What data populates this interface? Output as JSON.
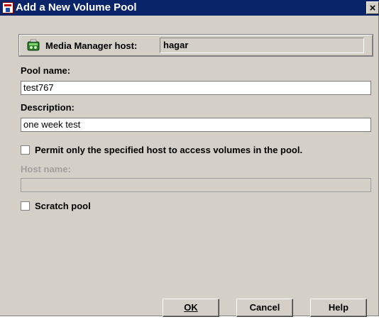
{
  "window": {
    "title": "Add a New Volume Pool",
    "close_label": "×"
  },
  "host": {
    "label": "Media Manager host:",
    "value": "hagar"
  },
  "pool_name": {
    "label": "Pool name:",
    "value": "test767"
  },
  "description": {
    "label": "Description:",
    "value": "one week test"
  },
  "permit_host": {
    "label": "Permit only the specified host to access volumes in the pool.",
    "checked": false
  },
  "host_name": {
    "label": "Host name:",
    "value": "",
    "disabled": true
  },
  "scratch_pool": {
    "label": "Scratch pool",
    "checked": false
  },
  "buttons": {
    "ok": "OK",
    "cancel": "Cancel",
    "help": "Help"
  },
  "colors": {
    "titlebar": "#0a246a",
    "dialog_bg": "#d4d0c8"
  },
  "icons": {
    "title": "volume-pool-icon",
    "host": "media-manager-host-icon"
  }
}
